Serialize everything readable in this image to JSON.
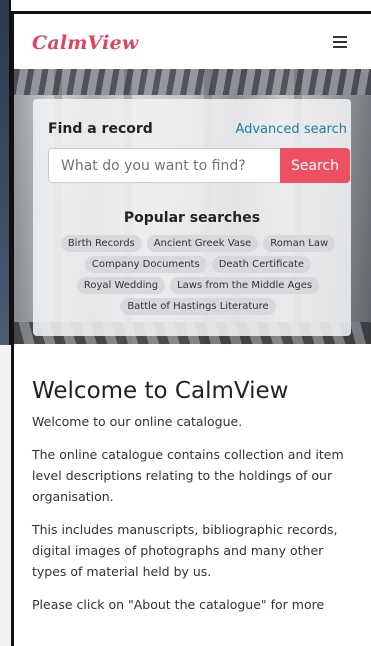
{
  "header": {
    "brand": "CalmView",
    "menu_icon": "hamburger-menu-icon"
  },
  "search": {
    "find_label": "Find a record",
    "advanced_link": "Advanced search",
    "placeholder": "What do you want to find?",
    "button_label": "Search",
    "popular_title": "Popular searches",
    "popular": [
      "Birth Records",
      "Ancient Greek Vase",
      "Roman Law",
      "Company Documents",
      "Death Certificate",
      "Royal Wedding",
      "Laws from the Middle Ages",
      "Battle of Hastings Literature"
    ]
  },
  "content": {
    "title": "Welcome to CalmView",
    "paragraphs": [
      "Welcome to our online catalogue.",
      "The online catalogue contains collection and item level descriptions relating to the holdings of our organisation.",
      "This includes manuscripts, bibliographic records, digital images of photographs and many other types of material held by us.",
      "Please click on \"About the catalogue\" for more"
    ]
  },
  "colors": {
    "brand": "#e0445c",
    "search_button": "#ef4f63",
    "link": "#1f7f9a"
  }
}
